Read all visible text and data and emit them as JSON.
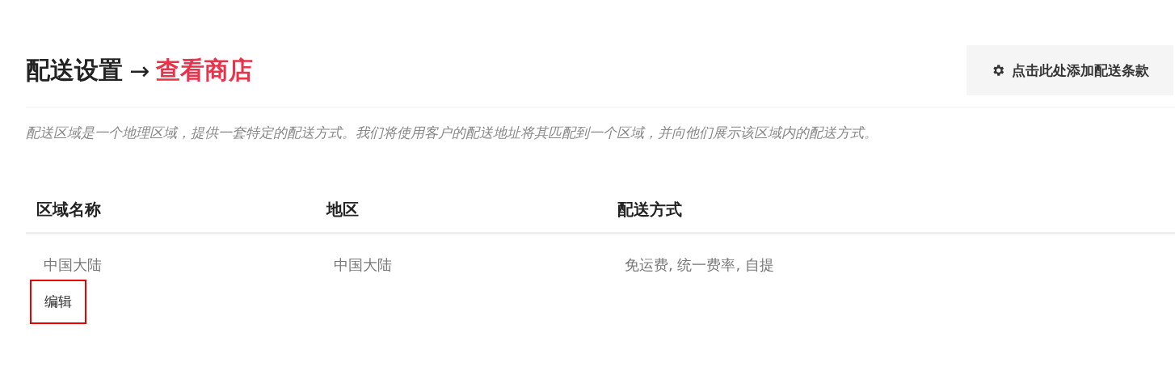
{
  "header": {
    "title": "配送设置",
    "arrow": "→",
    "link": "查看商店",
    "button": "点击此处添加配送条款"
  },
  "description": "配送区域是一个地理区域，提供一套特定的配送方式。我们将使用客户的配送地址将其匹配到一个区域，并向他们展示该区域内的配送方式。",
  "table": {
    "columns": [
      "区域名称",
      "地区",
      "配送方式"
    ],
    "rows": [
      {
        "zone": "中国大陆",
        "region": "中国大陆",
        "methods": "免运费, 统一费率, 自提",
        "action": "编辑",
        "highlighted": true
      }
    ]
  }
}
